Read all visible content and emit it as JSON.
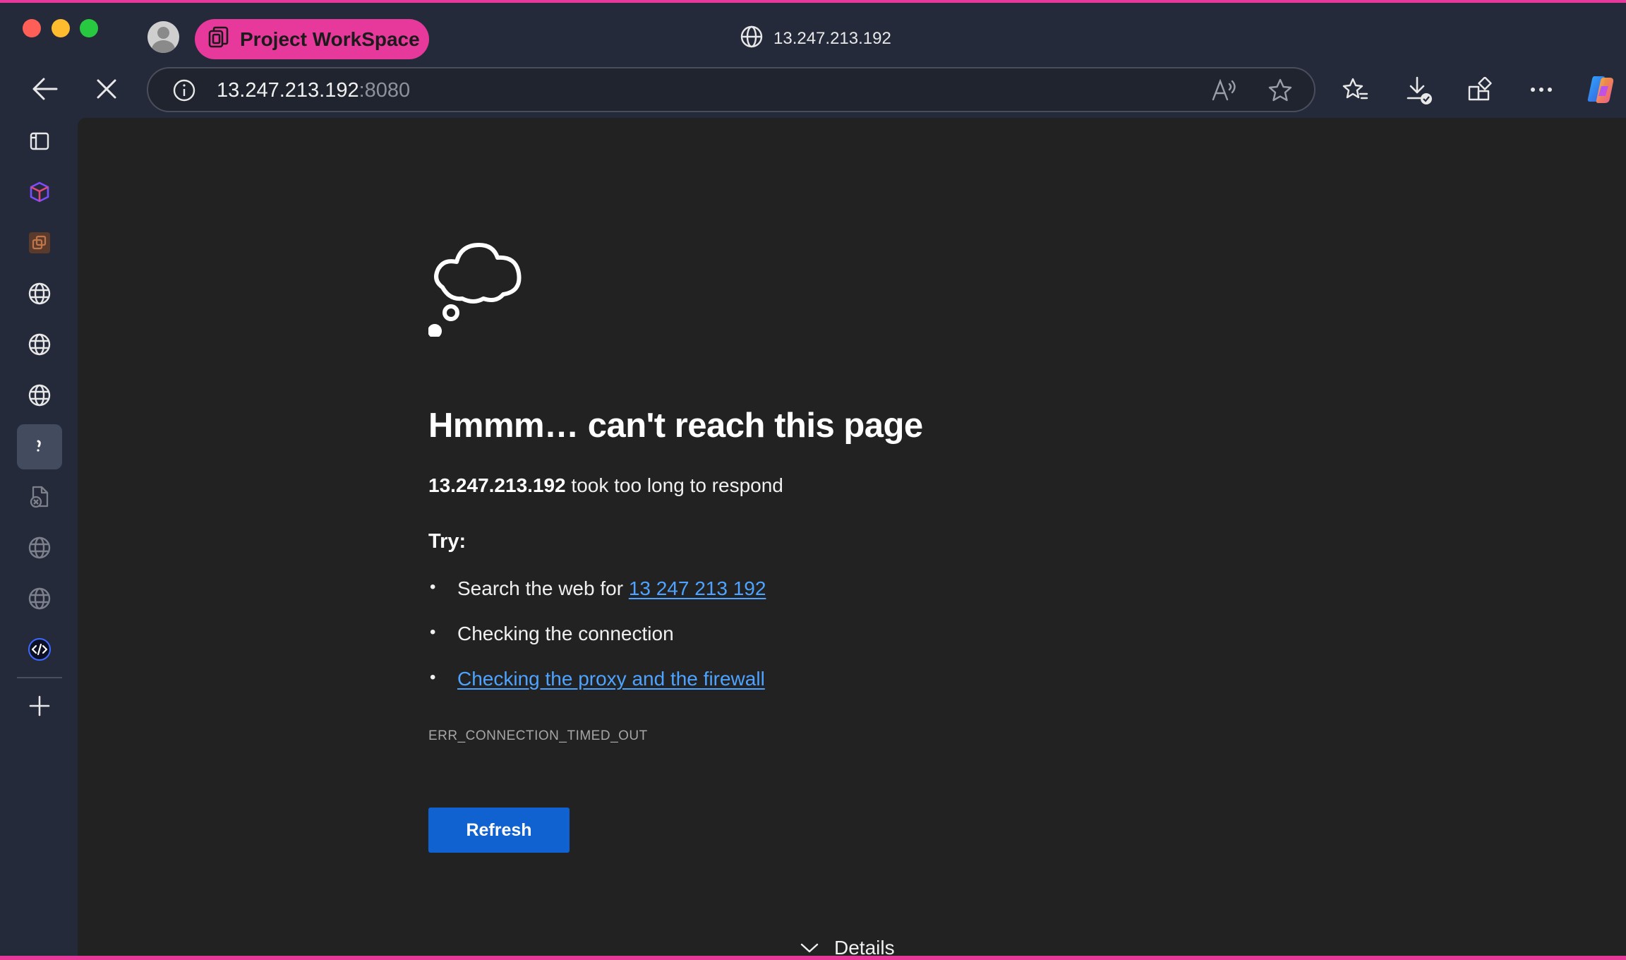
{
  "window": {
    "workspace_label": "Project WorkSpace",
    "tab_title": "13.247.213.192"
  },
  "toolbar": {
    "url_host": "13.247.213.192",
    "url_port": ":8080"
  },
  "error_page": {
    "title": "Hmmm… can't reach this page",
    "host": "13.247.213.192",
    "description_suffix": " took too long to respond",
    "try_label": "Try:",
    "suggestions": {
      "search_prefix": "Search the web for ",
      "search_link": "13 247 213 192",
      "check_connection": "Checking the connection",
      "proxy_link": "Checking the proxy and the firewall"
    },
    "error_code": "ERR_CONNECTION_TIMED_OUT",
    "refresh_label": "Refresh",
    "details_label": "Details"
  },
  "colors": {
    "frame_accent": "#e6399b",
    "window_bg": "#252a3a",
    "content_bg": "#222222",
    "link": "#4da3ff",
    "button": "#0f62cf"
  }
}
